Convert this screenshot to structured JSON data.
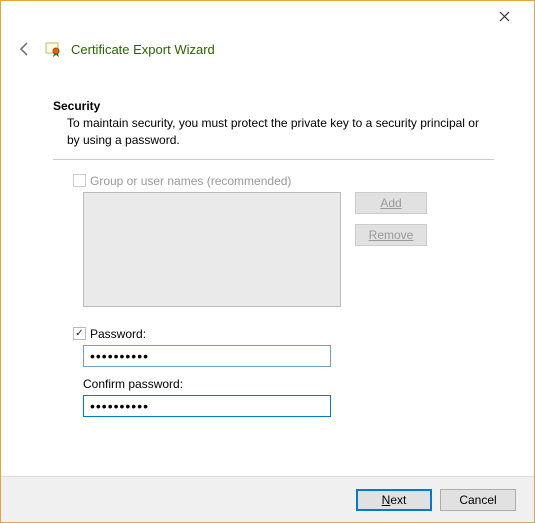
{
  "titlebar": {
    "close": "✕"
  },
  "header": {
    "title": "Certificate Export Wizard"
  },
  "section": {
    "title": "Security",
    "description": "To maintain security, you must protect the private key to a security principal or by using a password."
  },
  "group": {
    "checkbox_label": "Group or user names (recommended)",
    "checked": false,
    "add_label": "Add",
    "remove_label": "Remove"
  },
  "password": {
    "checkbox_label": "Password:",
    "checked": true,
    "value": "••••••••••",
    "confirm_label": "Confirm password:",
    "confirm_value": "••••••••••"
  },
  "footer": {
    "next_label": "Next",
    "cancel_label": "Cancel"
  }
}
